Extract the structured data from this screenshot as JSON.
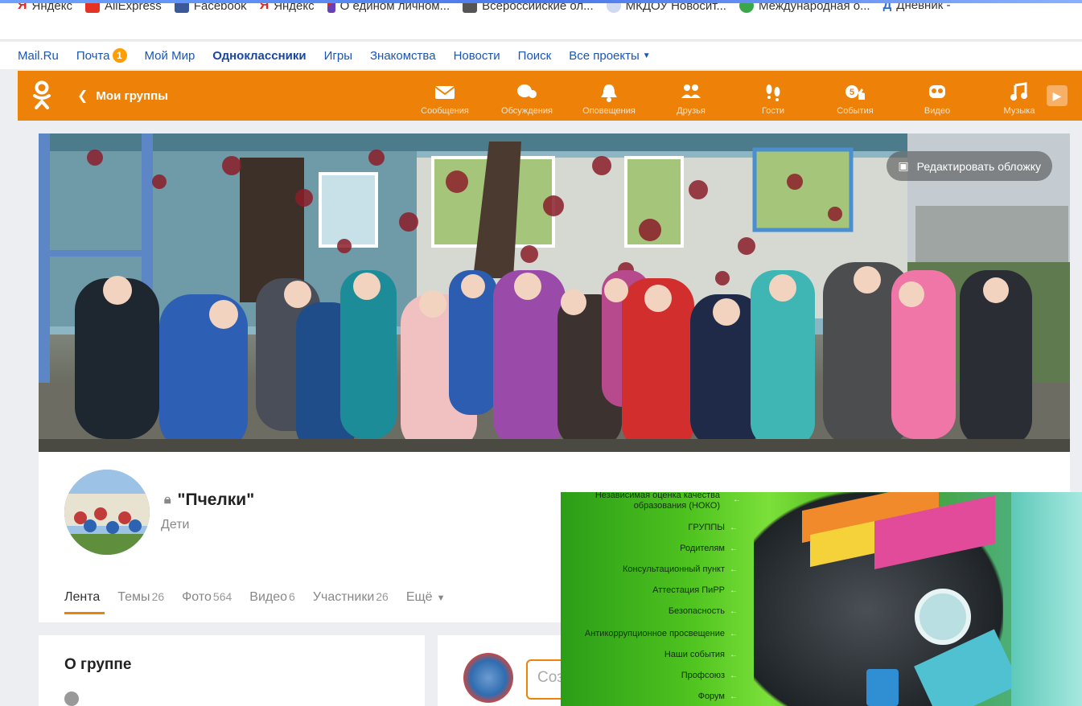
{
  "bookmarks": [
    {
      "label": "Яндекс",
      "icon": "yandex-icon",
      "color": "#e52620"
    },
    {
      "label": "AliExpress",
      "icon": "aliexpress-icon",
      "color": "#e43225"
    },
    {
      "label": "Facebook",
      "icon": "facebook-icon",
      "color": "#3b5998"
    },
    {
      "label": "Яндекс",
      "icon": "yandex-icon",
      "color": "#e52620"
    },
    {
      "label": "О едином личном...",
      "icon": "flag-icon",
      "color": "#6b3fb5"
    },
    {
      "label": "Всероссийские ол...",
      "icon": "document-icon",
      "color": "#555555"
    },
    {
      "label": "МКДОУ Новосит...",
      "icon": "emblem-icon",
      "color": "#5577cc"
    },
    {
      "label": "Международная о...",
      "icon": "globe-icon",
      "color": "#3aa84a"
    },
    {
      "label": "Дневник -",
      "icon": "diary-icon",
      "color": "#2a6ad0"
    }
  ],
  "mailbar": {
    "items": [
      "Mail.Ru",
      "Почта",
      "Мой Мир",
      "Одноклассники",
      "Игры",
      "Знакомства",
      "Новости",
      "Поиск",
      "Все проекты"
    ],
    "mail_badge": "1"
  },
  "okbar": {
    "back_label": "Мои группы",
    "nav": [
      "Сообщения",
      "Обсуждения",
      "Оповещения",
      "Друзья",
      "Гости",
      "События",
      "Видео",
      "Музыка"
    ]
  },
  "cover": {
    "edit_label": "Редактировать обложку"
  },
  "group": {
    "name": "\"Пчелки\"",
    "category": "Дети"
  },
  "tabs": [
    {
      "label": "Лента",
      "count": ""
    },
    {
      "label": "Темы",
      "count": "26"
    },
    {
      "label": "Фото",
      "count": "564"
    },
    {
      "label": "Видео",
      "count": "6"
    },
    {
      "label": "Участники",
      "count": "26"
    },
    {
      "label": "Ещё",
      "count": ""
    }
  ],
  "about": {
    "title": "О группе"
  },
  "post": {
    "placeholder": "Соз"
  },
  "site_menu": [
    "Независимая оценка качества образования (НОКО)",
    "ГРУППЫ",
    "Родителям",
    "Консультационный пункт",
    "Аттестация ПиРР",
    "Безопасность",
    "Антикоррупционное просвещение",
    "Наши события",
    "Профсоюз",
    "Форум"
  ],
  "colors": {
    "ok_orange": "#ee8208",
    "link_blue": "#1a56b8"
  }
}
